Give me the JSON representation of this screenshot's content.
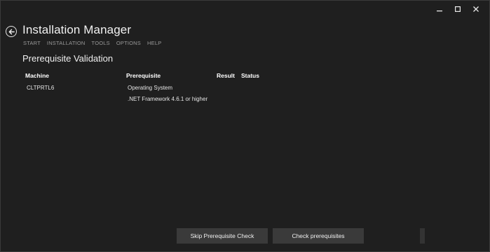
{
  "window": {
    "controls": {
      "minimize_icon": "minimize-icon",
      "maximize_icon": "maximize-icon",
      "close_icon": "close-icon"
    }
  },
  "header": {
    "back_icon": "back-arrow-icon",
    "title": "Installation Manager"
  },
  "menu": {
    "items": [
      "START",
      "INSTALLATION",
      "TOOLS",
      "OPTIONS",
      "HELP"
    ]
  },
  "page": {
    "title": "Prerequisite Validation"
  },
  "table": {
    "headers": {
      "machine": "Machine",
      "prerequisite": "Prerequisite",
      "result": "Result",
      "status": "Status"
    },
    "rows": [
      {
        "machine": "CLTPRTL6",
        "prerequisite": "Operating System",
        "result": "",
        "status": ""
      },
      {
        "machine": "",
        "prerequisite": ".NET Framework 4.6.1 or higher",
        "result": "",
        "status": ""
      }
    ]
  },
  "actions": {
    "skip_label": "Skip Prerequisite Check",
    "check_label": "Check prerequisites"
  },
  "colors": {
    "background": "#1f1f1f",
    "button": "#3a3a3a",
    "menu_text": "#9a9a9a"
  }
}
